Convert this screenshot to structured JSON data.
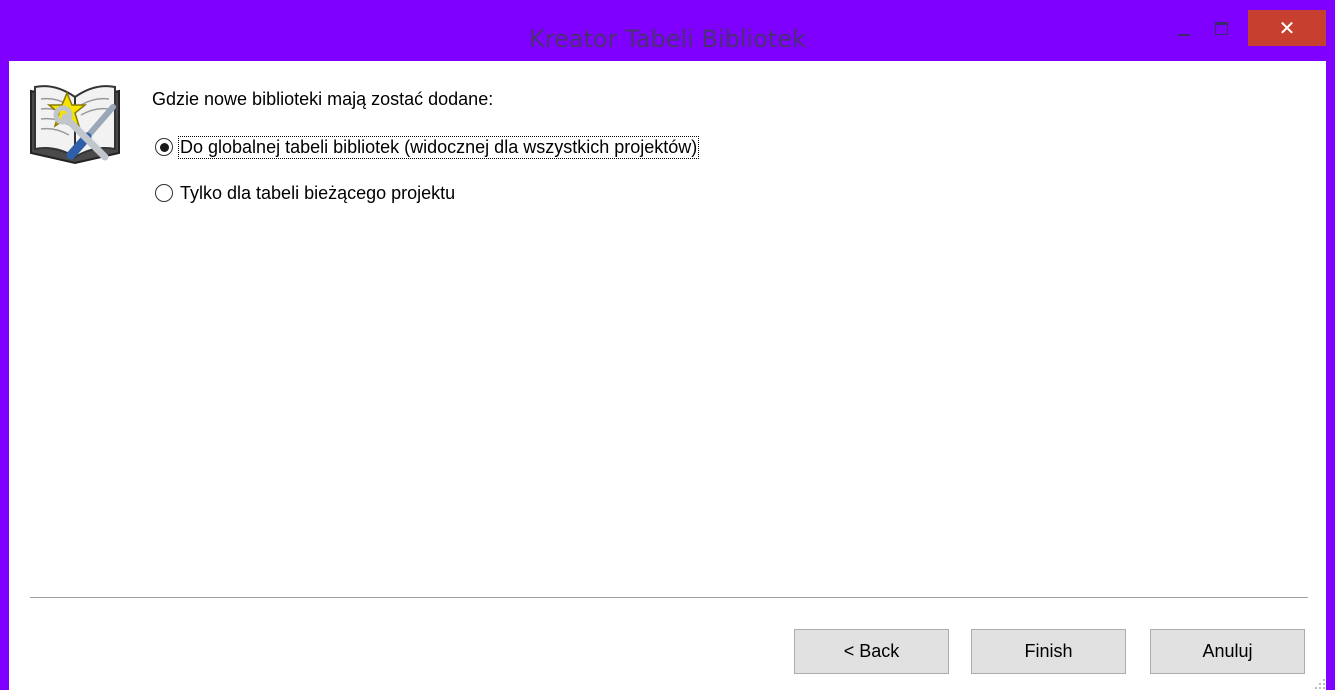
{
  "window": {
    "title": "Kreator Tabeli Bibliotek",
    "border_color": "#8000ff",
    "close_symbol": "✕"
  },
  "wizard": {
    "icon": "wizard-book-icon",
    "question": "Gdzie nowe biblioteki mają zostać dodane:",
    "options": [
      {
        "label": "Do globalnej tabeli bibliotek (widocznej dla wszystkich projektów)",
        "selected": true
      },
      {
        "label": "Tylko dla tabeli bieżącego projektu",
        "selected": false
      }
    ]
  },
  "buttons": {
    "back": "< Back",
    "finish": "Finish",
    "cancel": "Anuluj"
  }
}
